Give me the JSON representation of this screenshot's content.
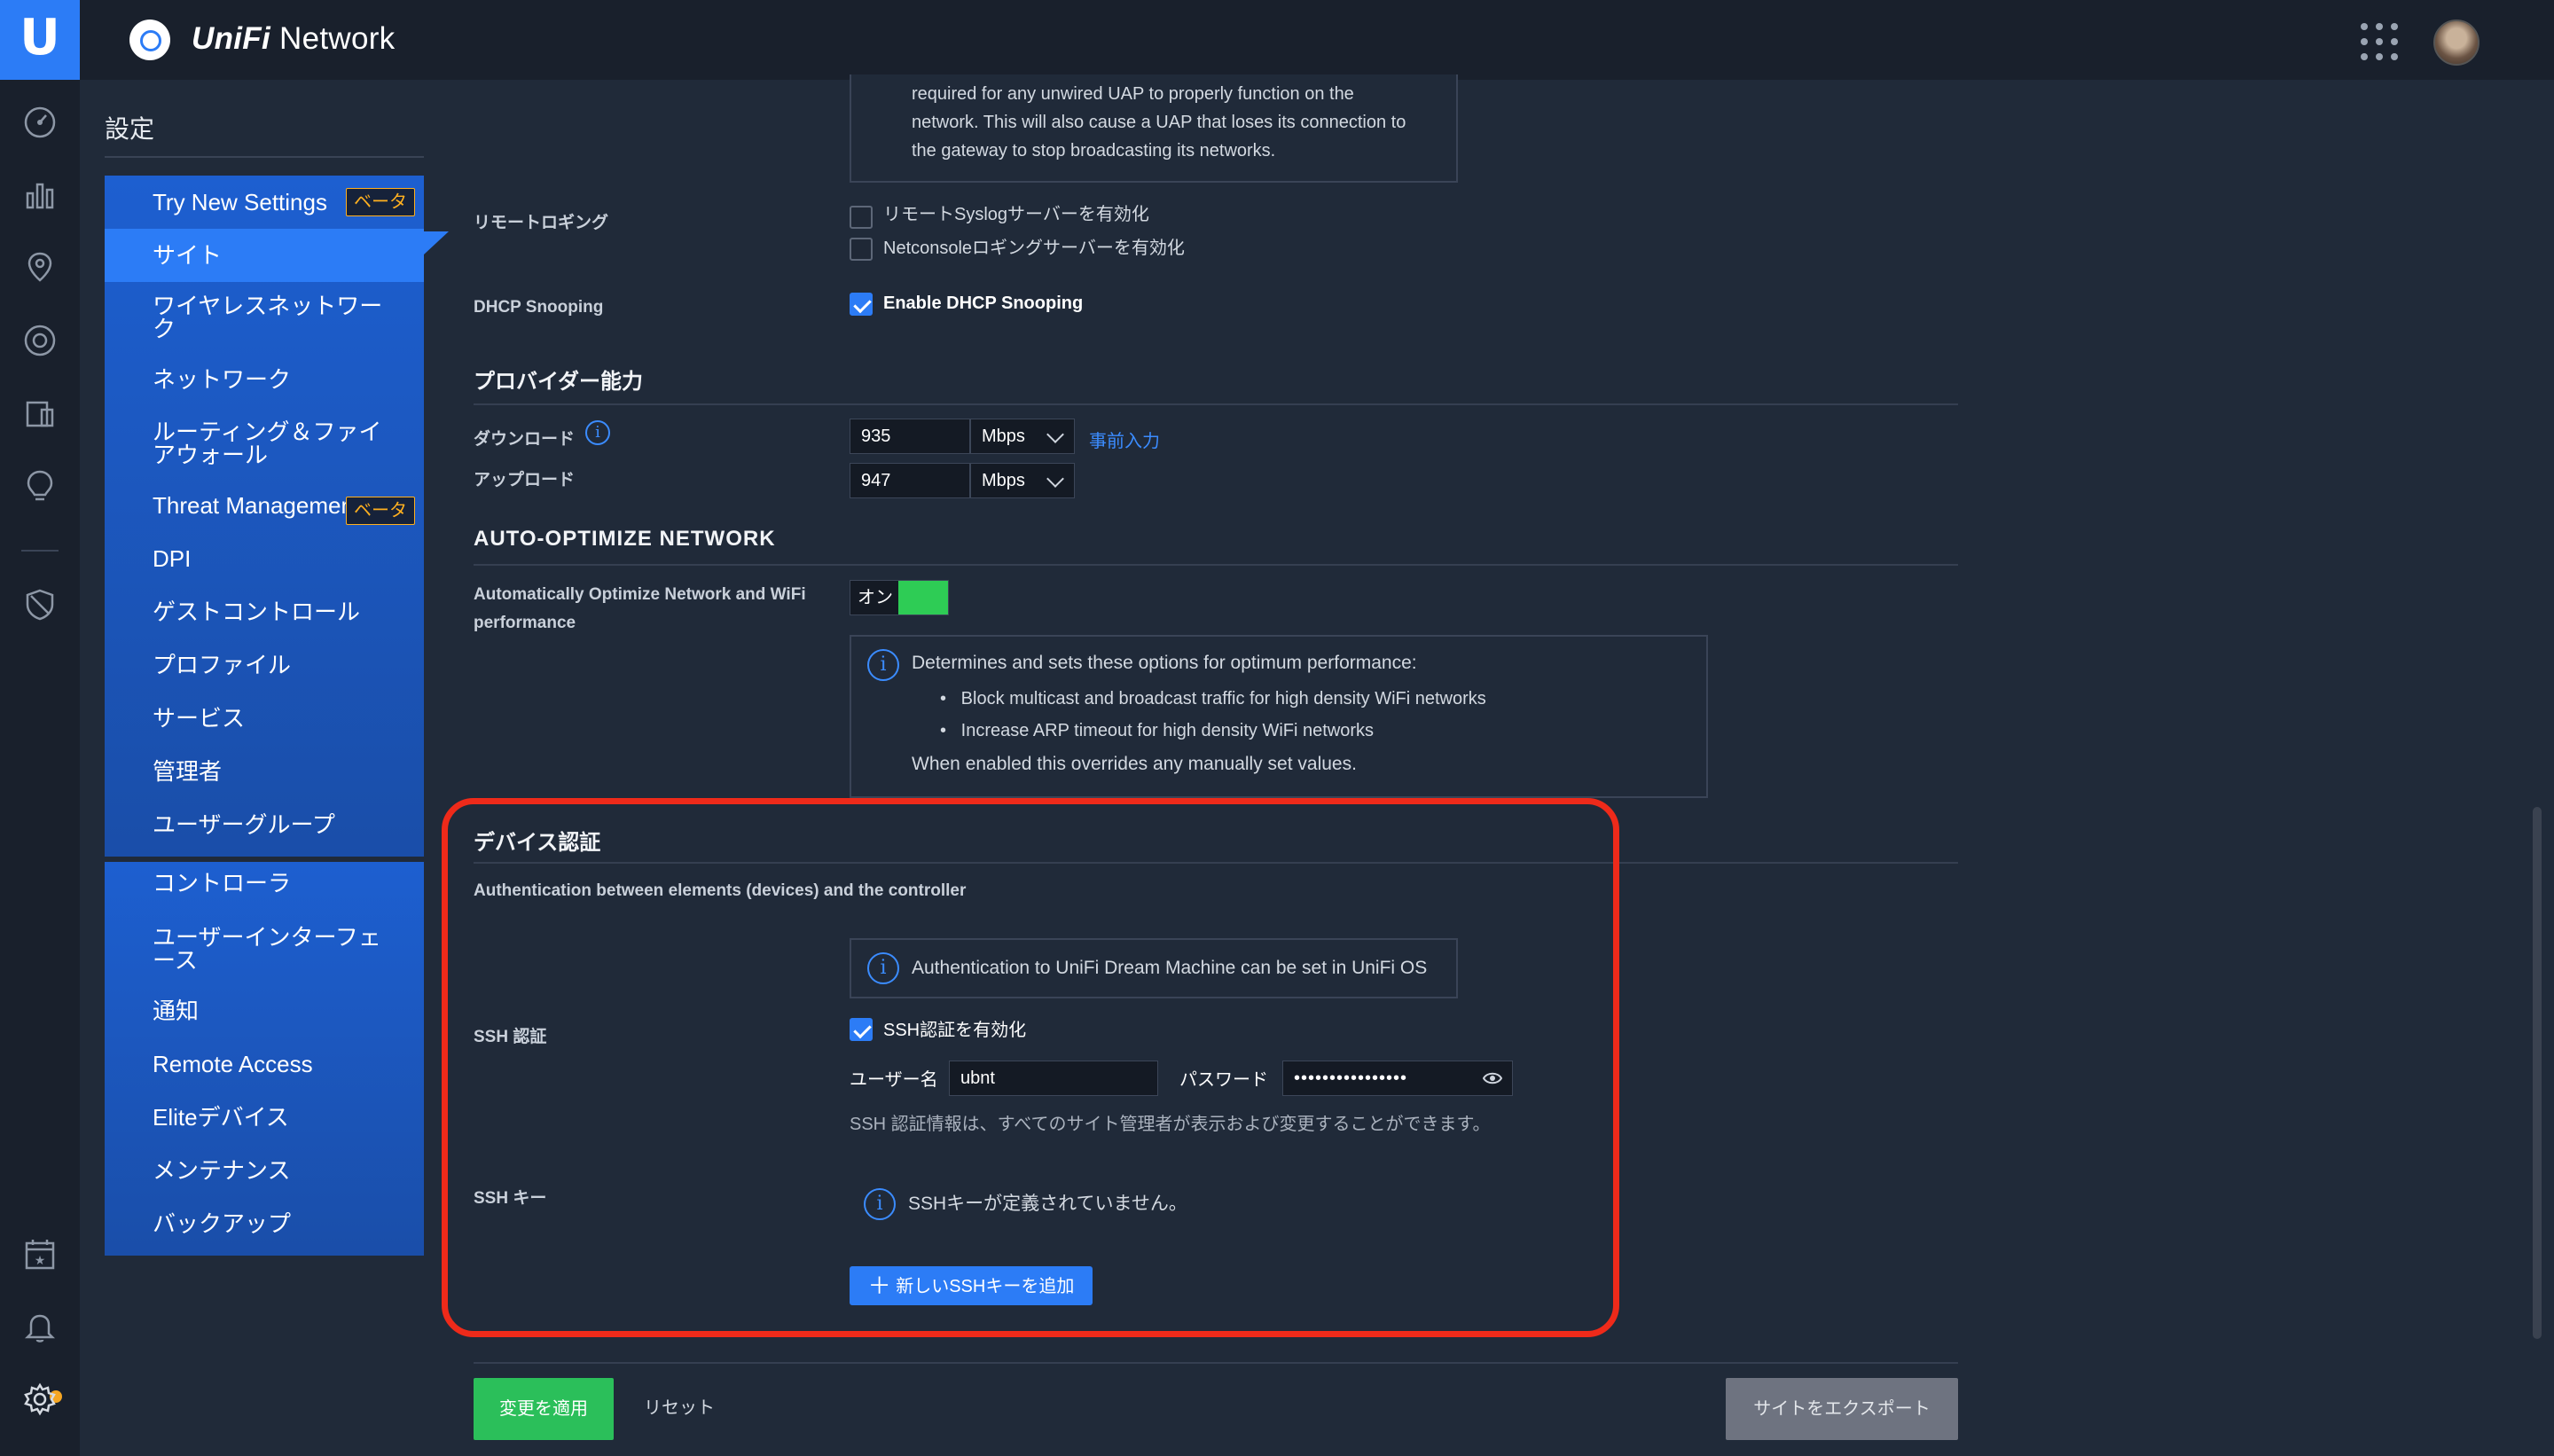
{
  "app": {
    "title_brand": "UniFi",
    "title_rest": " Network"
  },
  "settings": {
    "title": "設定"
  },
  "nav": {
    "items": [
      {
        "label": "Try New Settings",
        "badge": "ベータ"
      },
      {
        "label": "サイト",
        "active": true
      },
      {
        "label": "ワイヤレスネットワーク"
      },
      {
        "label": "ネットワーク"
      },
      {
        "label": "ルーティング＆ファイアウォール"
      },
      {
        "label": "Threat Managemen",
        "badge": "ベータ"
      },
      {
        "label": "DPI"
      },
      {
        "label": "ゲストコントロール"
      },
      {
        "label": "プロファイル"
      },
      {
        "label": "サービス"
      },
      {
        "label": "管理者"
      },
      {
        "label": "ユーザーグループ"
      }
    ],
    "items2": [
      {
        "label": "コントローラ"
      },
      {
        "label": "ユーザーインターフェース"
      },
      {
        "label": "通知"
      },
      {
        "label": "Remote Access"
      },
      {
        "label": "Eliteデバイス"
      },
      {
        "label": "メンテナンス"
      },
      {
        "label": "バックアップ"
      }
    ]
  },
  "top_note": {
    "lines": [
      "required for any unwired UAP to properly function on the",
      "network. This will also cause a UAP that loses its connection to",
      "the gateway to stop broadcasting its networks."
    ]
  },
  "remote_logging": {
    "label": "リモートロギング",
    "options": [
      {
        "label": "リモートSyslogサーバーを有効化",
        "checked": false
      },
      {
        "label": "Netconsoleロギングサーバーを有効化",
        "checked": false
      }
    ]
  },
  "dhcp": {
    "label": "DHCP Snooping",
    "option": "Enable DHCP Snooping",
    "checked": true
  },
  "provider": {
    "title": "プロバイダー能力",
    "download_label": "ダウンロード",
    "upload_label": "アップロード",
    "download_value": "935",
    "upload_value": "947",
    "unit": "Mbps",
    "prefill_link": "事前入力"
  },
  "auto_optimize": {
    "title": "AUTO-OPTIMIZE NETWORK",
    "label_line1": "Automatically Optimize Network and WiFi",
    "label_line2": "performance",
    "toggle_label": "オン",
    "toggle_on": true,
    "info_heading": "Determines and sets these options for optimum performance:",
    "bullets": [
      "Block multicast and broadcast traffic for high density WiFi networks",
      "Increase ARP timeout for high density WiFi networks"
    ],
    "info_footer": "When enabled this overrides any manually set values."
  },
  "device_auth": {
    "title": "デバイス認証",
    "subtitle": "Authentication between elements (devices) and the controller",
    "info": "Authentication to UniFi Dream Machine can be set in UniFi OS",
    "ssh_label": "SSH 認証",
    "ssh_enable": "SSH認証を有効化",
    "ssh_checked": true,
    "username_label": "ユーザー名",
    "username_value": "ubnt",
    "password_label": "パスワード",
    "password_value": "••••••••••••••••",
    "ssh_note": "SSH 認証情報は、すべてのサイト管理者が表示および変更することができます。",
    "ssh_key_label": "SSH キー",
    "ssh_key_empty": "SSHキーが定義されていません。",
    "add_key_button": "新しいSSHキーを追加"
  },
  "footer": {
    "apply": "変更を適用",
    "reset": "リセット",
    "export": "サイトをエクスポート"
  },
  "colors": {
    "accent": "#2c7cf6",
    "highlight": "#ee2a1a",
    "toggle_on": "#2ecc55",
    "beta_badge": "#ffb020"
  }
}
